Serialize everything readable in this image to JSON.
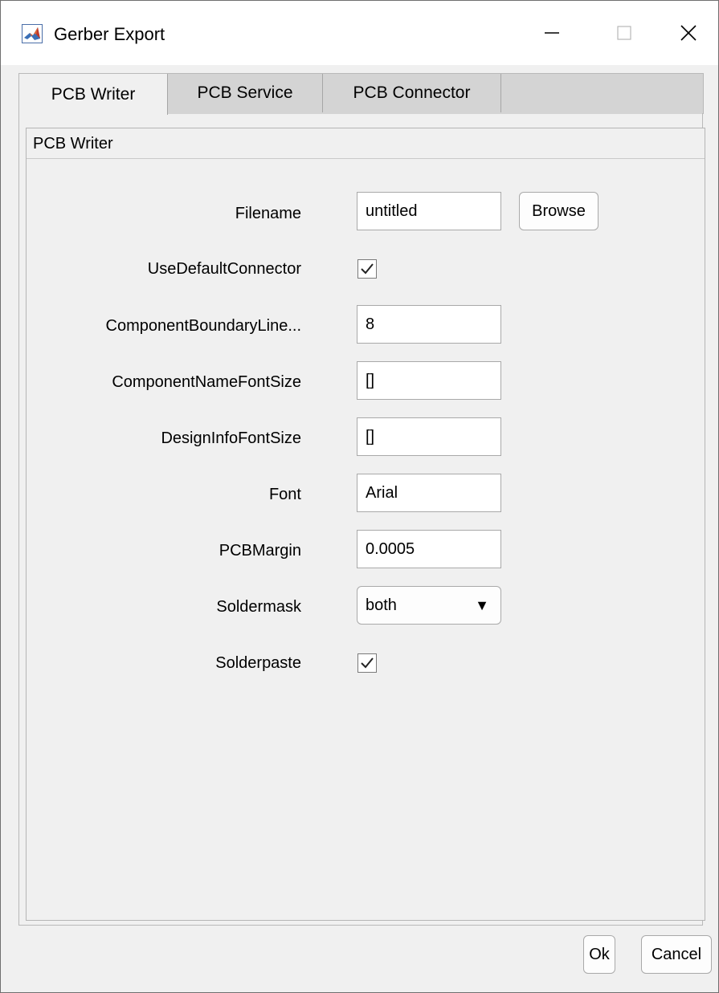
{
  "window": {
    "title": "Gerber Export",
    "minimize_glyph": "—",
    "close_glyph": "✕"
  },
  "tabs": [
    {
      "label": "PCB Writer",
      "active": true
    },
    {
      "label": "PCB Service",
      "active": false
    },
    {
      "label": "PCB Connector",
      "active": false
    }
  ],
  "panel": {
    "title": "PCB Writer"
  },
  "form": {
    "filename": {
      "label": "Filename",
      "value": "untitled",
      "browse_label": "Browse"
    },
    "use_default_connector": {
      "label": "UseDefaultConnector",
      "checked": true
    },
    "component_boundary": {
      "label": "ComponentBoundaryLine...",
      "value": "8"
    },
    "component_name_font_size": {
      "label": "ComponentNameFontSize",
      "value": "[]"
    },
    "design_info_font_size": {
      "label": "DesignInfoFontSize",
      "value": "[]"
    },
    "font": {
      "label": "Font",
      "value": "Arial"
    },
    "pcb_margin": {
      "label": "PCBMargin",
      "value": "0.0005"
    },
    "soldermask": {
      "label": "Soldermask",
      "value": "both",
      "arrow": "▼"
    },
    "solderpaste": {
      "label": "Solderpaste",
      "checked": true
    }
  },
  "footer": {
    "ok_label": "Ok",
    "cancel_label": "Cancel"
  },
  "colors": {
    "window_bg": "#f0f0f0",
    "titlebar_bg": "#ffffff",
    "tab_inactive_bg": "#d4d4d4",
    "matlab_icon_orange": "#e16737",
    "matlab_icon_blue": "#3b6fb6"
  },
  "icons": {
    "app": "matlab-logo-icon",
    "check": "check-icon"
  }
}
